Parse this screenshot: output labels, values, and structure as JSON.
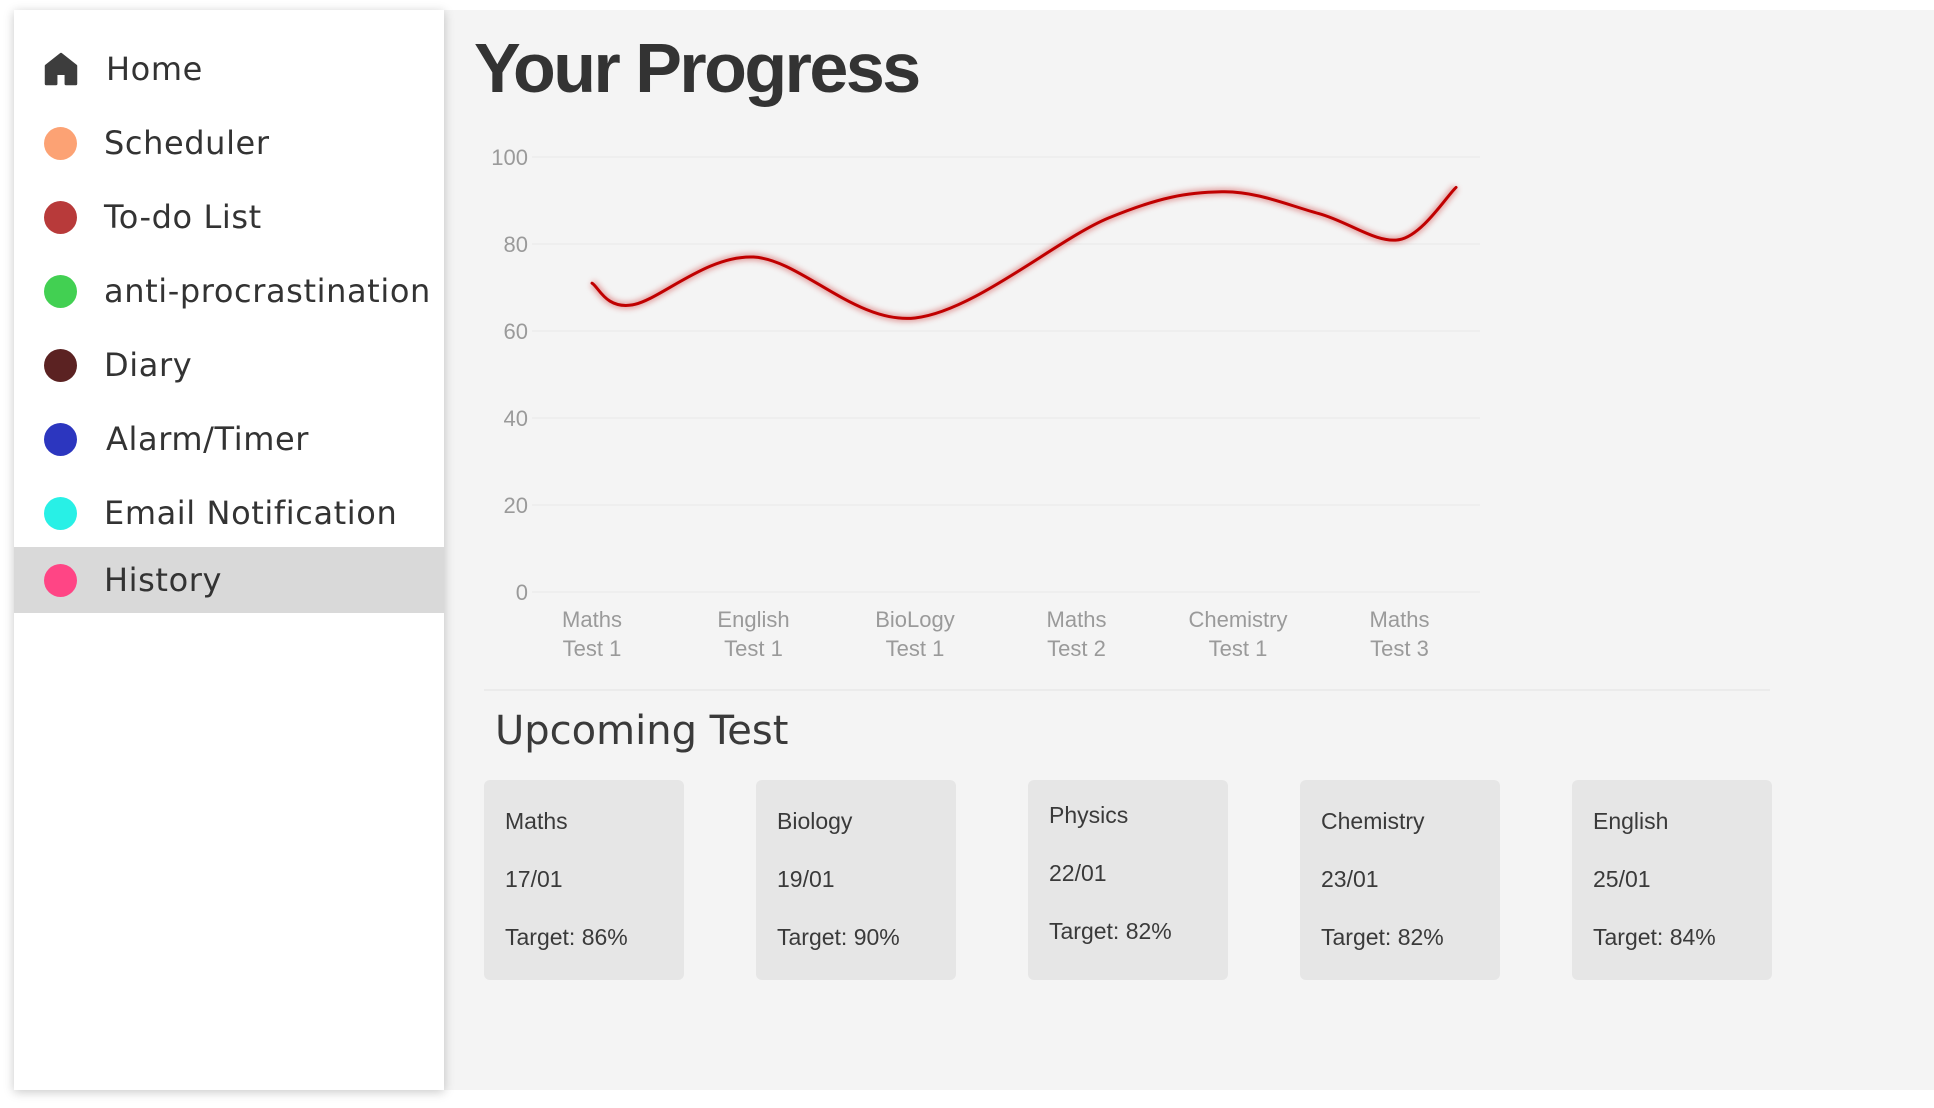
{
  "sidebar": {
    "items": [
      {
        "label": "Home",
        "icon": "home-icon",
        "color": "#3d3d3d",
        "active": false
      },
      {
        "label": "Scheduler",
        "icon": "dot-icon",
        "color": "#fca274",
        "active": false
      },
      {
        "label": "To-do List",
        "icon": "dot-icon",
        "color": "#b83a3a",
        "active": false
      },
      {
        "label": "anti-procrastination",
        "icon": "dot-icon",
        "color": "#42d052",
        "active": false
      },
      {
        "label": "Diary",
        "icon": "dot-icon",
        "color": "#5b2222",
        "active": false
      },
      {
        "label": "Alarm/Timer",
        "icon": "dot-icon",
        "color": "#2c36bf",
        "active": false
      },
      {
        "label": "Email Notification",
        "icon": "dot-icon",
        "color": "#28f0e6",
        "active": false
      },
      {
        "label": "History",
        "icon": "dot-icon",
        "color": "#ff4585",
        "active": true
      }
    ]
  },
  "main": {
    "title": "Your Progress",
    "upcoming_title": "Upcoming Test",
    "tests": [
      {
        "subject": "Maths",
        "date": "17/01",
        "target": "Target: 86%"
      },
      {
        "subject": "Biology",
        "date": "19/01",
        "target": "Target: 90%"
      },
      {
        "subject": "Physics",
        "date": "22/01",
        "target": "Target: 82%"
      },
      {
        "subject": "Chemistry",
        "date": "23/01",
        "target": "Target: 82%"
      },
      {
        "subject": "English",
        "date": "25/01",
        "target": "Target: 84%"
      }
    ]
  },
  "chart_data": {
    "type": "line",
    "title": "",
    "xlabel": "",
    "ylabel": "",
    "categories": [
      [
        "Maths",
        "Test 1"
      ],
      [
        "English",
        "Test 1"
      ],
      [
        "BioLogy",
        "Test 1"
      ],
      [
        "Maths",
        "Test 2"
      ],
      [
        "Chemistry",
        "Test 1"
      ],
      [
        "Maths",
        "Test 3"
      ]
    ],
    "yticks": [
      "100",
      "80",
      "60",
      "40",
      "20",
      "0"
    ],
    "ylim": [
      0,
      100
    ],
    "grid": true,
    "smooth": true,
    "series": [
      {
        "name": "",
        "color": "#c00000",
        "points": [
          {
            "x": 0.0,
            "y": 71
          },
          {
            "x": 0.25,
            "y": 66
          },
          {
            "x": 1.0,
            "y": 77
          },
          {
            "x": 2.0,
            "y": 63
          },
          {
            "x": 3.2,
            "y": 86
          },
          {
            "x": 3.9,
            "y": 92
          },
          {
            "x": 4.5,
            "y": 87
          },
          {
            "x": 5.0,
            "y": 81
          },
          {
            "x": 5.35,
            "y": 93
          }
        ]
      }
    ]
  }
}
